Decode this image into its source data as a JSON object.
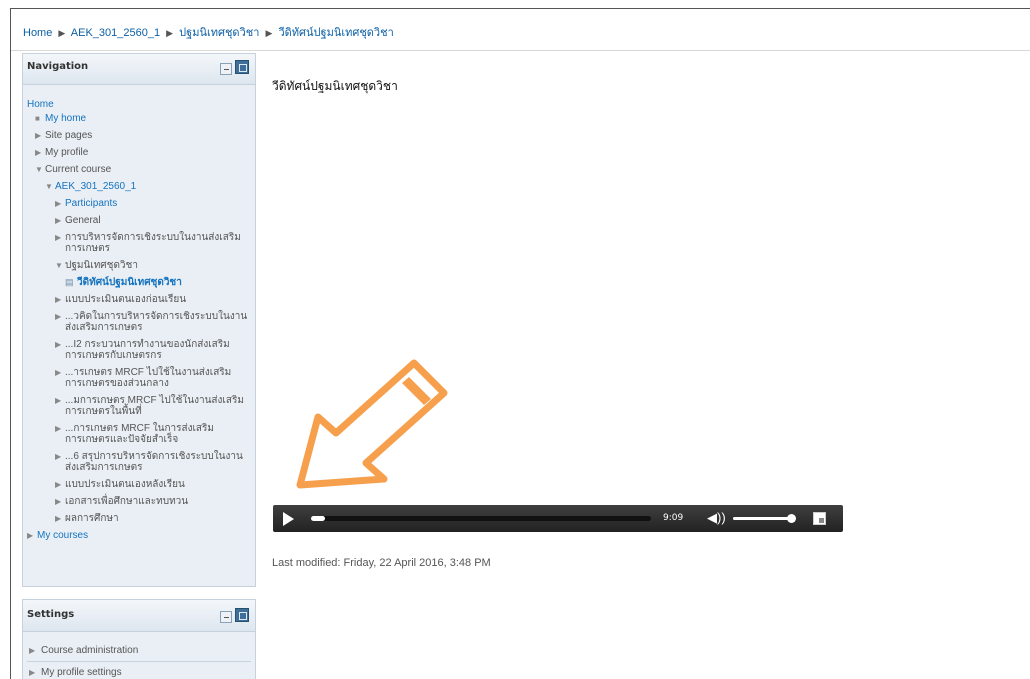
{
  "breadcrumb": {
    "separator": "▶",
    "items": [
      {
        "label": "Home"
      },
      {
        "label": "AEK_301_2560_1"
      },
      {
        "label": "ปฐมนิเทศชุดวิชา"
      },
      {
        "label": "วีดิทัศน์ปฐมนิเทศชุดวิชา"
      }
    ]
  },
  "navigation": {
    "title": "Navigation",
    "home": "Home",
    "items": [
      {
        "label": "My home",
        "arrow": "■"
      },
      {
        "label": "Site pages",
        "arrow": "▶"
      },
      {
        "label": "My profile",
        "arrow": "▶"
      },
      {
        "label": "Current course",
        "arrow": "▼"
      },
      {
        "label": "AEK_301_2560_1",
        "arrow": "▼"
      },
      {
        "label": "Participants",
        "arrow": "▶"
      },
      {
        "label": "General",
        "arrow": "▶"
      },
      {
        "label": "การบริหารจัดการเชิงระบบในงานส่งเสริมการเกษตร",
        "arrow": "▶"
      },
      {
        "label": "ปฐมนิเทศชุดวิชา",
        "arrow": "▼"
      },
      {
        "label": "วีดิทัศน์ปฐมนิเทศชุดวิชา",
        "icon": "▤"
      },
      {
        "label": "แบบประเมินตนเองก่อนเรียน",
        "arrow": "▶"
      },
      {
        "label": "...วคิดในการบริหารจัดการเชิงระบบในงานส่งเสริมการเกษตร",
        "arrow": "▶"
      },
      {
        "label": "...I2 กระบวนการทำงานของนักส่งเสริมการเกษตรกับเกษตรกร",
        "arrow": "▶"
      },
      {
        "label": "...ารเกษตร MRCF ไปใช้ในงานส่งเสริมการเกษตรของส่วนกลาง",
        "arrow": "▶"
      },
      {
        "label": "...มการเกษตร MRCF ไปใช้ในงานส่งเสริมการเกษตรในพื้นที่",
        "arrow": "▶"
      },
      {
        "label": "...การเกษตร MRCF ในการส่งเสริมการเกษตรและปัจจัยสำเร็จ",
        "arrow": "▶"
      },
      {
        "label": "...6 สรุปการบริหารจัดการเชิงระบบในงานส่งเสริมการเกษตร",
        "arrow": "▶"
      },
      {
        "label": "แบบประเมินตนเองหลังเรียน",
        "arrow": "▶"
      },
      {
        "label": "เอกสารเพื่อศึกษาและทบทวน",
        "arrow": "▶"
      },
      {
        "label": "ผลการศึกษา",
        "arrow": "▶"
      },
      {
        "label": "My courses",
        "arrow": "▶"
      }
    ]
  },
  "settings": {
    "title": "Settings",
    "items": [
      {
        "label": "Course administration",
        "arrow": "▶"
      },
      {
        "label": "My profile settings",
        "arrow": "▶"
      }
    ]
  },
  "main": {
    "heading": "วีดิทัศน์ปฐมนิเทศชุดวิชา",
    "last_modified": "Last modified: Friday, 22 April 2016, 3:48 PM"
  },
  "player": {
    "time": "9:09",
    "play_icon": "play-icon",
    "volume_icon_name": "volume-icon",
    "volume_glyph": "◀))",
    "progress_fraction": 0.04,
    "volume_fraction": 1.0
  },
  "colors": {
    "link": "#1673bf",
    "arrow_fill": "#f6a04d",
    "player_bg": "#2a2a2a"
  },
  "annotation": {
    "arrow_icon": "orange-pointer-arrow"
  }
}
